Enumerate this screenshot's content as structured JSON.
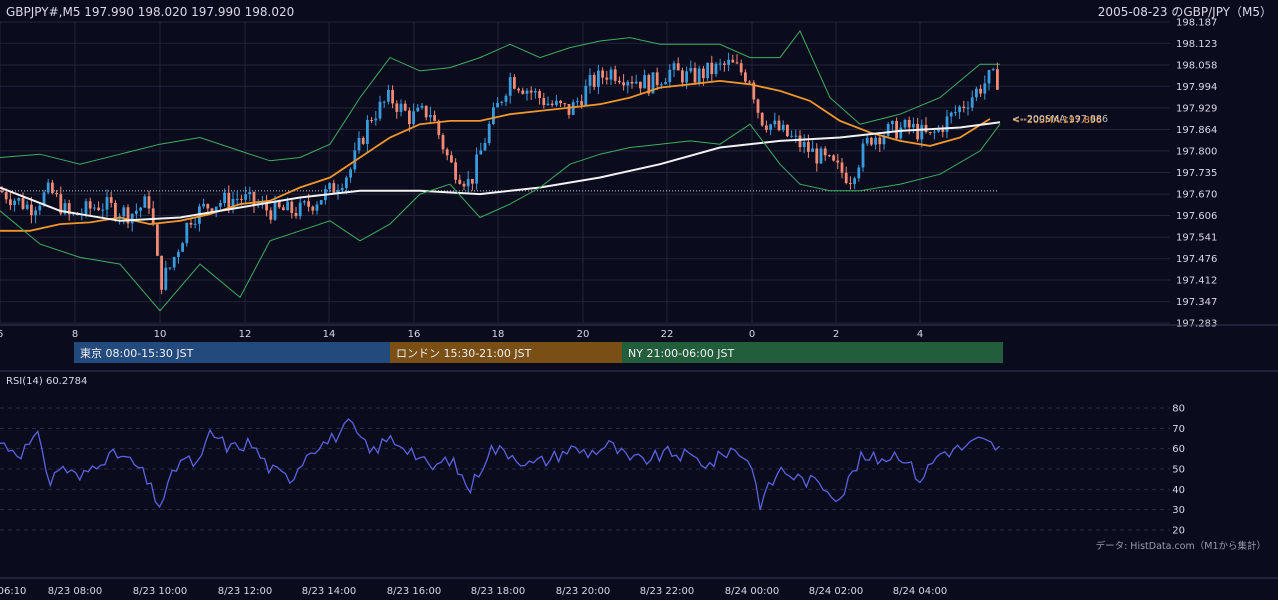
{
  "header": {
    "symbol_info": "GBPJPY#,M5 197.990 198.020 197.990 198.020",
    "chart_title": "2005-08-23 のGBP/JPY（M5）"
  },
  "source_note": "データ: HistData.com（M1から集計）",
  "rsi_label": "RSI(14) 60.2784",
  "sma_label": "<--20SMA:197.896",
  "sma200_label": "<--200SMA:197.886",
  "sessions": [
    {
      "label": "東京 08:00-15:30 JST",
      "color": "#234a7c"
    },
    {
      "label": "ロンドン 15:30-21:00 JST",
      "color": "#7a4f15"
    },
    {
      "label": "NY 21:00-06:00 JST",
      "color": "#235e3c"
    }
  ],
  "colors": {
    "up": "#3a9bdc",
    "down": "#f08a72",
    "sma20": "#f0962a",
    "sma200": "#f2f2f2",
    "bollinger": "#3fae5e",
    "rsi": "#5a63e0",
    "grid": "#23233a"
  },
  "chart_data": [
    {
      "type": "candlestick",
      "title": "2005-08-23 のGBP/JPY（M5）",
      "y_ticks": [
        198.187,
        198.123,
        198.058,
        197.994,
        197.929,
        197.864,
        197.8,
        197.735,
        197.67,
        197.606,
        197.541,
        197.476,
        197.412,
        197.347,
        197.283
      ],
      "ylim": [
        197.283,
        198.187
      ],
      "x_ticks": [
        "6",
        "8",
        "10",
        "12",
        "14",
        "16",
        "18",
        "20",
        "22",
        "0",
        "2",
        "4"
      ],
      "reference_line": 197.68,
      "overlays": [
        "Bollinger Bands",
        "20SMA",
        "200SMA"
      ],
      "series": [
        {
          "name": "20SMA",
          "x": [
            0,
            30,
            60,
            90,
            120,
            150,
            180,
            210,
            240,
            270,
            300,
            330,
            360,
            390,
            420,
            450,
            480,
            510,
            540,
            570,
            600,
            630,
            660,
            690,
            720,
            750,
            780,
            810,
            840,
            870,
            900,
            930,
            960,
            990
          ],
          "values": [
            197.56,
            197.56,
            197.58,
            197.585,
            197.6,
            197.58,
            197.59,
            197.61,
            197.64,
            197.65,
            197.69,
            197.72,
            197.78,
            197.84,
            197.88,
            197.89,
            197.89,
            197.91,
            197.92,
            197.93,
            197.94,
            197.96,
            197.99,
            198.0,
            198.01,
            198.0,
            197.98,
            197.95,
            197.89,
            197.855,
            197.83,
            197.815,
            197.84,
            197.896
          ]
        },
        {
          "name": "200SMA",
          "x": [
            0,
            60,
            120,
            180,
            240,
            300,
            360,
            420,
            480,
            540,
            600,
            660,
            720,
            780,
            840,
            900,
            960,
            1000
          ],
          "values": [
            197.69,
            197.62,
            197.59,
            197.6,
            197.63,
            197.66,
            197.68,
            197.68,
            197.67,
            197.69,
            197.72,
            197.76,
            197.81,
            197.83,
            197.84,
            197.86,
            197.87,
            197.886
          ]
        },
        {
          "name": "Bollinger Upper",
          "x": [
            0,
            40,
            80,
            120,
            160,
            200,
            240,
            270,
            300,
            330,
            360,
            390,
            420,
            450,
            480,
            510,
            540,
            570,
            600,
            630,
            660,
            690,
            720,
            750,
            780,
            800,
            830,
            860,
            900,
            940,
            980,
            1000
          ],
          "values": [
            197.78,
            197.79,
            197.76,
            197.79,
            197.82,
            197.84,
            197.8,
            197.77,
            197.78,
            197.82,
            197.96,
            198.08,
            198.04,
            198.05,
            198.08,
            198.12,
            198.08,
            198.11,
            198.13,
            198.14,
            198.12,
            198.12,
            198.12,
            198.08,
            198.08,
            198.16,
            197.96,
            197.88,
            197.91,
            197.96,
            198.06,
            198.06
          ]
        },
        {
          "name": "Bollinger Lower",
          "x": [
            0,
            40,
            80,
            120,
            160,
            200,
            240,
            270,
            300,
            330,
            360,
            390,
            420,
            450,
            480,
            510,
            540,
            570,
            600,
            630,
            660,
            690,
            720,
            750,
            780,
            800,
            830,
            860,
            900,
            940,
            980,
            1000
          ],
          "values": [
            197.62,
            197.52,
            197.48,
            197.46,
            197.32,
            197.46,
            197.36,
            197.53,
            197.56,
            197.59,
            197.53,
            197.58,
            197.67,
            197.7,
            197.6,
            197.64,
            197.69,
            197.76,
            197.79,
            197.81,
            197.82,
            197.83,
            197.82,
            197.88,
            197.76,
            197.7,
            197.68,
            197.68,
            197.7,
            197.73,
            197.8,
            197.88
          ]
        }
      ],
      "price_path": {
        "x": [
          0,
          30,
          50,
          70,
          100,
          130,
          150,
          160,
          170,
          190,
          210,
          240,
          270,
          300,
          330,
          350,
          370,
          390,
          410,
          430,
          450,
          470,
          490,
          510,
          530,
          550,
          570,
          590,
          610,
          630,
          650,
          670,
          690,
          710,
          730,
          750,
          760,
          780,
          800,
          830,
          850,
          870,
          890,
          910,
          930,
          950,
          970,
          990,
          1000
        ],
        "values": [
          197.68,
          197.63,
          197.68,
          197.6,
          197.64,
          197.61,
          197.65,
          197.4,
          197.45,
          197.6,
          197.64,
          197.66,
          197.62,
          197.62,
          197.68,
          197.74,
          197.9,
          197.96,
          197.9,
          197.92,
          197.76,
          197.7,
          197.88,
          198.02,
          197.98,
          197.94,
          197.92,
          198.0,
          198.04,
          198.02,
          198.0,
          198.04,
          198.02,
          198.04,
          198.06,
          198.02,
          197.9,
          197.86,
          197.82,
          197.76,
          197.72,
          197.84,
          197.86,
          197.87,
          197.84,
          197.9,
          197.96,
          198.02,
          198.01
        ]
      }
    },
    {
      "type": "line",
      "title": "RSI(14) 60.2784",
      "y_ticks": [
        80,
        70,
        60,
        50,
        40,
        30,
        20
      ],
      "ylim": [
        20,
        80
      ],
      "series": [
        {
          "name": "RSI(14)",
          "x": [
            0,
            20,
            40,
            50,
            60,
            80,
            100,
            120,
            140,
            160,
            180,
            200,
            210,
            230,
            250,
            270,
            290,
            310,
            330,
            350,
            370,
            390,
            410,
            430,
            450,
            470,
            490,
            510,
            530,
            550,
            570,
            590,
            610,
            630,
            650,
            670,
            690,
            710,
            730,
            750,
            760,
            780,
            800,
            820,
            840,
            860,
            880,
            900,
            920,
            940,
            960,
            980,
            1000
          ],
          "values": [
            63,
            58,
            66,
            42,
            52,
            45,
            55,
            57,
            50,
            32,
            55,
            52,
            68,
            60,
            63,
            50,
            45,
            60,
            64,
            72,
            58,
            65,
            60,
            50,
            55,
            40,
            60,
            58,
            52,
            55,
            60,
            58,
            62,
            54,
            55,
            58,
            56,
            52,
            60,
            55,
            33,
            50,
            45,
            43,
            36,
            55,
            55,
            58,
            45,
            58,
            60,
            64,
            60
          ]
        }
      ]
    }
  ],
  "time_axis_labels": [
    "06:10",
    "8/23 08:00",
    "8/23 10:00",
    "8/23 12:00",
    "8/23 14:00",
    "8/23 16:00",
    "8/23 18:00",
    "8/23 20:00",
    "8/23 22:00",
    "8/24 00:00",
    "8/24 02:00",
    "8/24 04:00"
  ]
}
